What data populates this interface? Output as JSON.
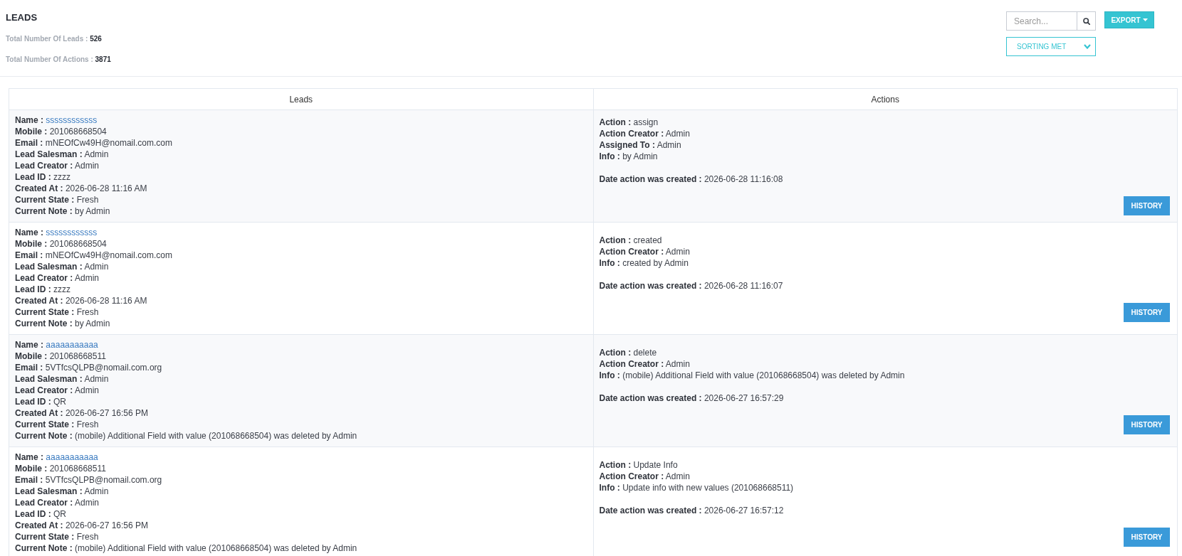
{
  "page": {
    "title": "LEADS"
  },
  "stats": [
    {
      "label": "Total Number Of Leads :",
      "value": "526"
    },
    {
      "label": "Total Number Of Actions :",
      "value": "3871"
    }
  ],
  "search": {
    "placeholder": "Search..."
  },
  "export_button": {
    "label": "EXPORT"
  },
  "sort_dropdown": {
    "value": "SORTING MET"
  },
  "table": {
    "columns": [
      "Leads",
      "Actions"
    ],
    "rows": [
      {
        "lead": [
          {
            "label": "Name :",
            "value": "ssssssssssss",
            "kind": "link"
          },
          {
            "label": "Mobile :",
            "value": "201068668504",
            "kind": "text"
          },
          {
            "label": "Email :",
            "value": "mNEOfCw49H@nomail.com.com",
            "kind": "text"
          },
          {
            "label": "Lead Salesman :",
            "value": "Admin",
            "kind": "text"
          },
          {
            "label": "Lead Creator :",
            "value": "Admin",
            "kind": "text"
          },
          {
            "label": "Lead ID :",
            "value": "zzzz",
            "kind": "text"
          },
          {
            "label": "Created At :",
            "value": "2026-06-28 11:16 AM",
            "kind": "text"
          },
          {
            "label": "Current State :",
            "value": "Fresh",
            "kind": "text"
          },
          {
            "label": "Current Note :",
            "value": "by Admin",
            "kind": "text"
          }
        ],
        "action": {
          "details": [
            {
              "label": "Action :",
              "value": "assign"
            },
            {
              "label": "Action Creator :",
              "value": "Admin"
            },
            {
              "label": "Assigned To :",
              "value": "Admin"
            },
            {
              "label": "Info :",
              "value": "by Admin"
            }
          ],
          "date": {
            "label": "Date action was created :",
            "value": "2026-06-28 11:16:08"
          }
        },
        "button": "HISTORY"
      },
      {
        "lead": [
          {
            "label": "Name :",
            "value": "ssssssssssss",
            "kind": "link"
          },
          {
            "label": "Mobile :",
            "value": "201068668504",
            "kind": "text"
          },
          {
            "label": "Email :",
            "value": "mNEOfCw49H@nomail.com.com",
            "kind": "text"
          },
          {
            "label": "Lead Salesman :",
            "value": "Admin",
            "kind": "text"
          },
          {
            "label": "Lead Creator :",
            "value": "Admin",
            "kind": "text"
          },
          {
            "label": "Lead ID :",
            "value": "zzzz",
            "kind": "text"
          },
          {
            "label": "Created At :",
            "value": "2026-06-28 11:16 AM",
            "kind": "text"
          },
          {
            "label": "Current State :",
            "value": "Fresh",
            "kind": "text"
          },
          {
            "label": "Current Note :",
            "value": "by Admin",
            "kind": "text"
          }
        ],
        "action": {
          "details": [
            {
              "label": "Action :",
              "value": "created"
            },
            {
              "label": "Action Creator :",
              "value": "Admin"
            },
            {
              "label": "Info :",
              "value": "created by Admin"
            }
          ],
          "date": {
            "label": "Date action was created :",
            "value": "2026-06-28 11:16:07"
          }
        },
        "button": "HISTORY"
      },
      {
        "lead": [
          {
            "label": "Name :",
            "value": "aaaaaaaaaaa",
            "kind": "link"
          },
          {
            "label": "Mobile :",
            "value": "201068668511",
            "kind": "text"
          },
          {
            "label": "Email :",
            "value": "5VTfcsQLPB@nomail.com.org",
            "kind": "text"
          },
          {
            "label": "Lead Salesman :",
            "value": "Admin",
            "kind": "text"
          },
          {
            "label": "Lead Creator :",
            "value": "Admin",
            "kind": "text"
          },
          {
            "label": "Lead ID :",
            "value": "QR",
            "kind": "text"
          },
          {
            "label": "Created At :",
            "value": "2026-06-27 16:56 PM",
            "kind": "text"
          },
          {
            "label": "Current State :",
            "value": "Fresh",
            "kind": "text"
          },
          {
            "label": "Current Note :",
            "value": "(mobile) Additional Field with value (201068668504) was deleted by Admin",
            "kind": "text"
          }
        ],
        "action": {
          "details": [
            {
              "label": "Action :",
              "value": "delete"
            },
            {
              "label": "Action Creator :",
              "value": "Admin"
            },
            {
              "label": "Info :",
              "value": "(mobile) Additional Field with value (201068668504) was deleted by Admin"
            }
          ],
          "date": {
            "label": "Date action was created :",
            "value": "2026-06-27 16:57:29"
          }
        },
        "button": "HISTORY"
      },
      {
        "lead": [
          {
            "label": "Name :",
            "value": "aaaaaaaaaaa",
            "kind": "link"
          },
          {
            "label": "Mobile :",
            "value": "201068668511",
            "kind": "text"
          },
          {
            "label": "Email :",
            "value": "5VTfcsQLPB@nomail.com.org",
            "kind": "text"
          },
          {
            "label": "Lead Salesman :",
            "value": "Admin",
            "kind": "text"
          },
          {
            "label": "Lead Creator :",
            "value": "Admin",
            "kind": "text"
          },
          {
            "label": "Lead ID :",
            "value": "QR",
            "kind": "text"
          },
          {
            "label": "Created At :",
            "value": "2026-06-27 16:56 PM",
            "kind": "text"
          },
          {
            "label": "Current State :",
            "value": "Fresh",
            "kind": "text"
          },
          {
            "label": "Current Note :",
            "value": "(mobile) Additional Field with value (201068668504) was deleted by Admin",
            "kind": "text"
          }
        ],
        "action": {
          "details": [
            {
              "label": "Action :",
              "value": "Update Info"
            },
            {
              "label": "Action Creator :",
              "value": "Admin"
            },
            {
              "label": "Info :",
              "value": "Update info with new values (201068668511)"
            }
          ],
          "date": {
            "label": "Date action was created :",
            "value": "2026-06-27 16:57:12"
          }
        },
        "button": "HISTORY"
      }
    ]
  }
}
